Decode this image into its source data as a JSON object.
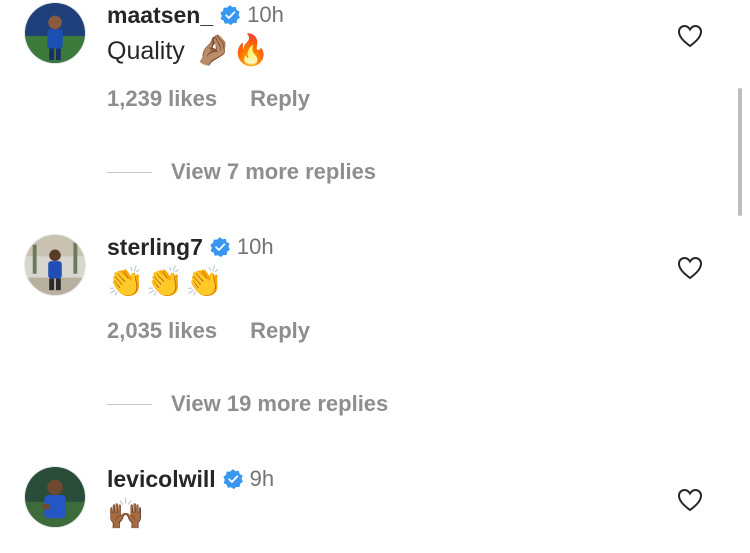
{
  "comments": [
    {
      "username": "maatsen_",
      "time": "10h",
      "text": "Quality",
      "emojis": "🤌🏽🔥",
      "likes": "1,239 likes",
      "reply_label": "Reply",
      "view_more": "View 7 more replies"
    },
    {
      "username": "sterling7",
      "time": "10h",
      "text": "",
      "emojis": "👏👏👏",
      "likes": "2,035 likes",
      "reply_label": "Reply",
      "view_more": "View 19 more replies"
    },
    {
      "username": "levicolwill",
      "time": "9h",
      "text": "",
      "emojis": "🙌🏾",
      "likes": "",
      "reply_label": "",
      "view_more": ""
    }
  ],
  "icons": {
    "verified": "verified-badge-icon",
    "like": "heart-outline-icon"
  },
  "colors": {
    "verified_blue": "#3897f0",
    "secondary_text": "#8e8e8e",
    "primary_text": "#262626"
  }
}
